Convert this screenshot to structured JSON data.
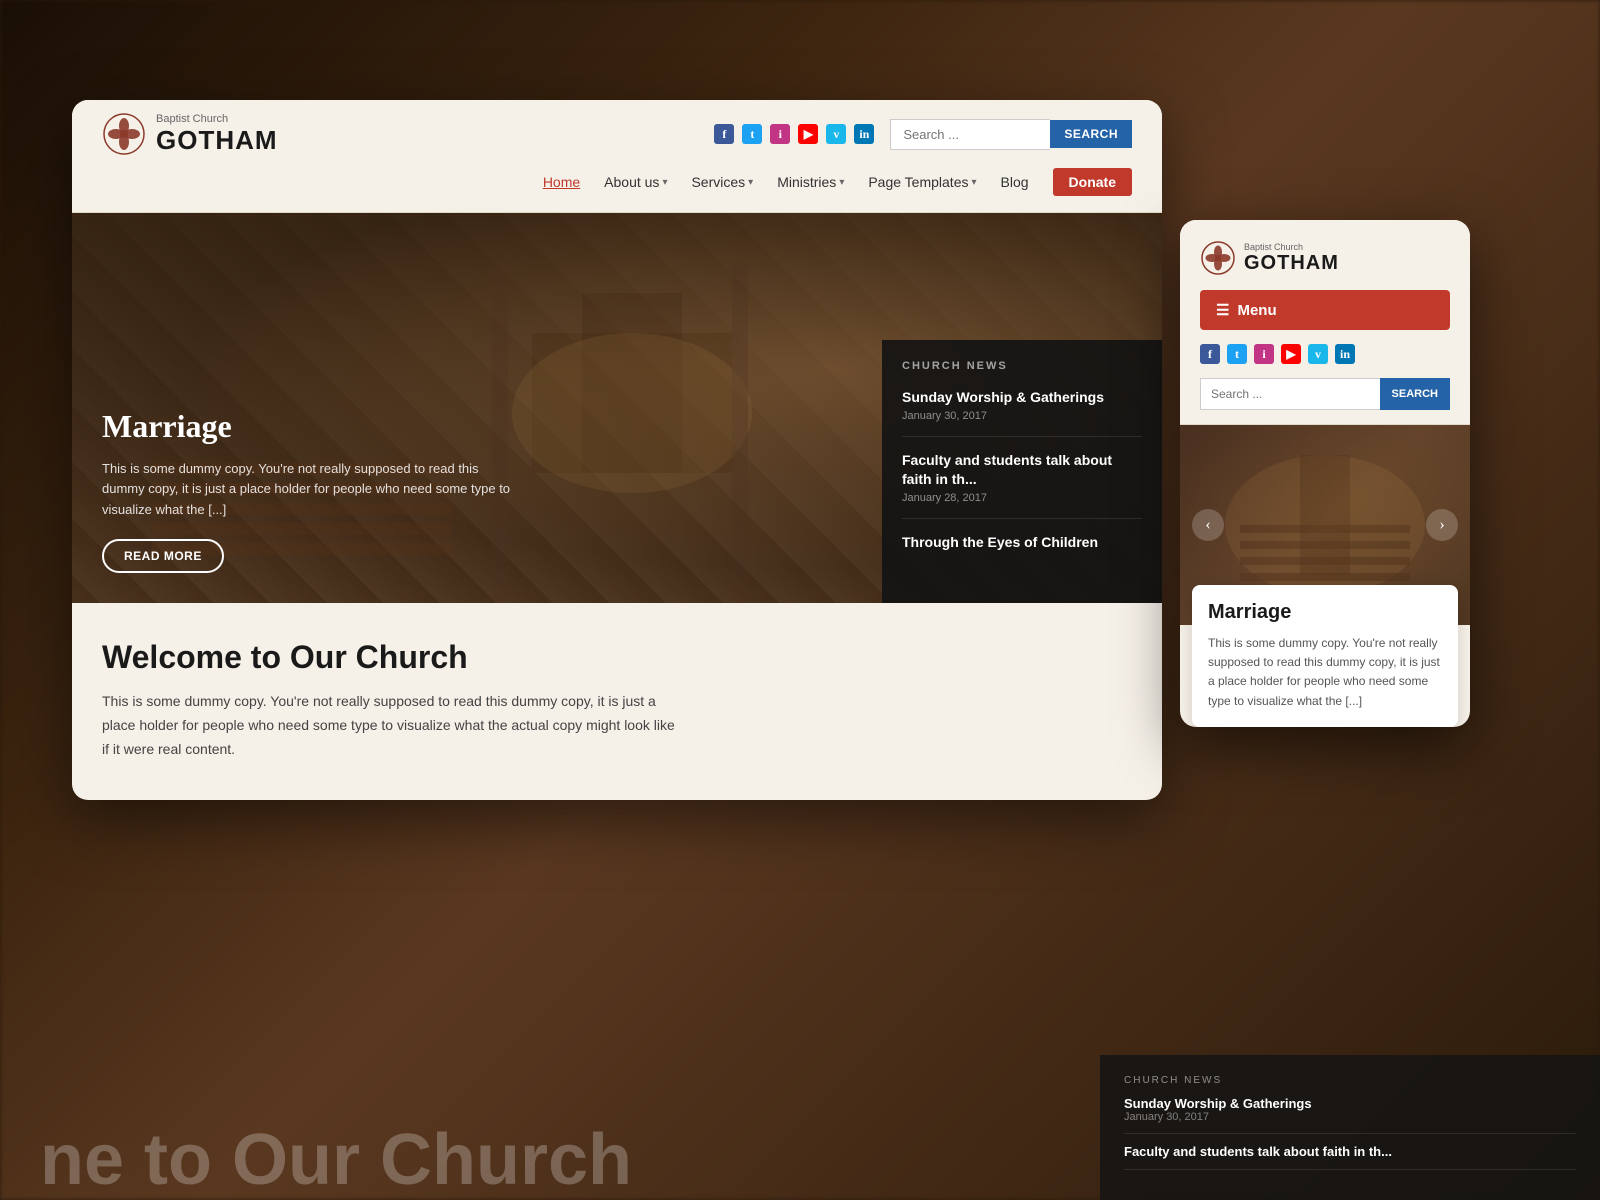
{
  "site": {
    "name": "GOTHAM",
    "subtitle": "Baptist Church",
    "tagline": "Baptist Church"
  },
  "header": {
    "search_placeholder": "Search ...",
    "search_button": "SEARCH",
    "nav": {
      "home": "Home",
      "about": "About us",
      "services": "Services",
      "ministries": "Ministries",
      "page_templates": "Page Templates",
      "blog": "Blog",
      "donate": "Donate"
    }
  },
  "hero": {
    "title": "Marriage",
    "body": "This is some dummy copy. You're not really supposed to read this dummy copy, it is just a place holder for people who need some type to visualize what the [...]",
    "read_more": "READ MORE"
  },
  "church_news": {
    "label": "CHURCH NEWS",
    "items": [
      {
        "title": "Sunday Worship & Gatherings",
        "date": "January 30, 2017"
      },
      {
        "title": "Faculty and students talk about faith in th...",
        "date": "January 28, 2017"
      },
      {
        "title": "Through the Eyes of Children",
        "date": ""
      }
    ]
  },
  "welcome": {
    "title": "Welcome to Our Church",
    "body": "This is some dummy copy. You're not really supposed to read this dummy copy, it is just a place holder for people who need some type to visualize what the actual copy might look like if it were real content."
  },
  "mobile": {
    "menu_label": "Menu",
    "search_placeholder": "Search ...",
    "search_button": "SEARCH",
    "card_title": "Marriage",
    "card_body": "This is some dummy copy. You're not really supposed to read this dummy copy, it is just a place holder for people who need some type to visualize what the [...]"
  },
  "social": {
    "facebook": "f",
    "twitter": "t",
    "instagram": "i",
    "youtube": "▶",
    "vimeo": "v",
    "linkedin": "in"
  },
  "bg_text": {
    "line1": "ne to Our Church",
    "body": "This is some dummy copy. You're not really supposed to read"
  },
  "bottom_news": {
    "label": "CHURCH NEWS",
    "items": [
      {
        "title": "Sunday Worship & Gatherings",
        "date": "January 30, 2017"
      },
      {
        "title": "Faculty and students talk about faith in th...",
        "date": ""
      }
    ]
  },
  "colors": {
    "primary_red": "#c0392b",
    "primary_blue": "#2563a8",
    "logo_red": "#8b3a2a",
    "dark_bg": "rgba(20,20,20,0.92)",
    "light_bg": "#f5f0e8"
  }
}
